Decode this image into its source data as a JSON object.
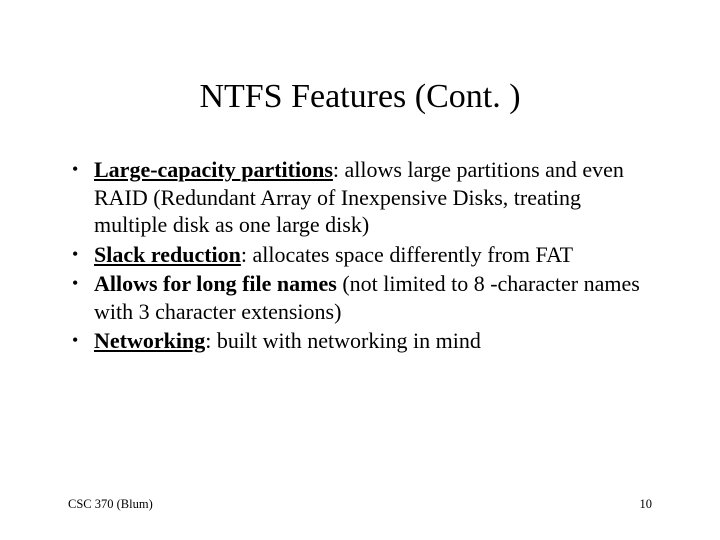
{
  "title": "NTFS Features (Cont. )",
  "bullets": [
    {
      "bold": "Large-capacity partitions",
      "rest": ": allows large partitions and even RAID (Redundant Array of Inexpensive Disks, treating multiple disk as one large disk)"
    },
    {
      "bold": "Slack reduction",
      "rest": ": allocates space differently from FAT"
    },
    {
      "bold": "Allows for long file names",
      "rest": " (not limited to 8 -character names with 3 character extensions)"
    },
    {
      "bold": "Networking",
      "rest": ": built with networking in mind"
    }
  ],
  "footer": {
    "left": "CSC 370 (Blum)",
    "right": "10"
  }
}
